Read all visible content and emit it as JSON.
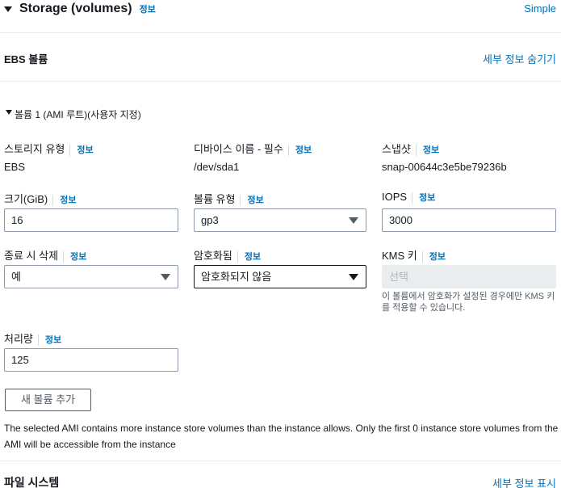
{
  "section": {
    "title": "Storage (volumes)",
    "info": "정보",
    "mode_link": "Simple"
  },
  "ebs": {
    "title": "EBS 볼륨",
    "hide_details": "세부 정보 숨기기"
  },
  "volume": {
    "title": "볼륨 1 (AMI 루트)(사용자 지정)",
    "storage_type": {
      "label": "스토리지 유형",
      "info": "정보",
      "value": "EBS"
    },
    "device_name": {
      "label": "디바이스 이름 - 필수",
      "info": "정보",
      "value": "/dev/sda1"
    },
    "snapshot": {
      "label": "스냅샷",
      "info": "정보",
      "value": "snap-00644c3e5be79236b"
    },
    "size": {
      "label": "크기(GiB)",
      "info": "정보",
      "value": "16"
    },
    "volume_type": {
      "label": "볼륨 유형",
      "info": "정보",
      "value": "gp3"
    },
    "iops": {
      "label": "IOPS",
      "info": "정보",
      "value": "3000"
    },
    "delete_on_termination": {
      "label": "종료 시 삭제",
      "info": "정보",
      "value": "예"
    },
    "encrypted": {
      "label": "암호화됨",
      "info": "정보",
      "value": "암호화되지 않음"
    },
    "kms_key": {
      "label": "KMS 키",
      "info": "정보",
      "placeholder": "선택",
      "hint": "이 볼륨에서 암호화가 설정된 경우에만 KMS 키를 적용할 수 있습니다."
    },
    "throughput": {
      "label": "처리량",
      "info": "정보",
      "value": "125"
    }
  },
  "add_volume_button": "새 볼륨 추가",
  "warning_text": "The selected AMI contains more instance store volumes than the instance allows. Only the first 0 instance store volumes from the AMI will be accessible from the instance",
  "filesystem": {
    "title": "파일 시스템",
    "show_details": "세부 정보 표시"
  }
}
